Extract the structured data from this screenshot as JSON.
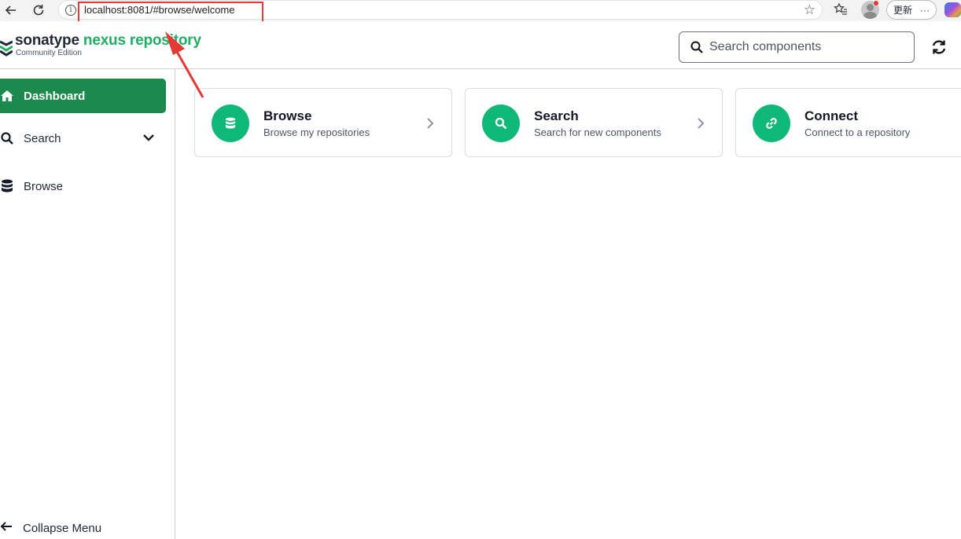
{
  "browser": {
    "url": "localhost:8081/#browse/welcome",
    "update_label": "更新",
    "more_label": "···"
  },
  "header": {
    "logo_brand": "sonatype",
    "logo_product": "nexus repository",
    "logo_edition": "Community Edition",
    "search_placeholder": "Search components"
  },
  "sidebar": {
    "items": [
      {
        "label": "Dashboard",
        "icon": "home-icon",
        "active": true
      },
      {
        "label": "Search",
        "icon": "search-icon",
        "expandable": true
      },
      {
        "label": "Browse",
        "icon": "database-icon"
      }
    ],
    "collapse_label": "Collapse Menu"
  },
  "cards": [
    {
      "title": "Browse",
      "description": "Browse my repositories",
      "icon": "database-icon"
    },
    {
      "title": "Search",
      "description": "Search for new components",
      "icon": "search-icon"
    },
    {
      "title": "Connect",
      "description": "Connect to a repository",
      "icon": "link-icon"
    }
  ],
  "colors": {
    "brand_green": "#1fae62",
    "active_nav": "#1b8a4c",
    "card_icon_bg": "#0fb877",
    "annotation_red": "#e53935"
  }
}
